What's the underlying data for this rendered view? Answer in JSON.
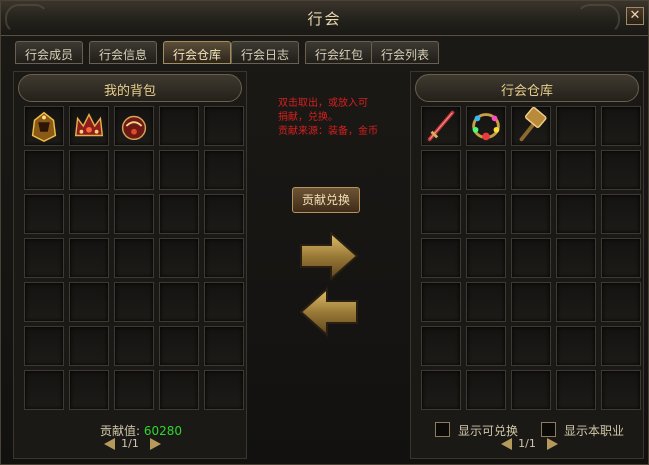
{
  "window": {
    "title": "行会"
  },
  "tabs": [
    {
      "label": "行会成员",
      "active": false
    },
    {
      "label": "行会信息",
      "active": false
    },
    {
      "label": "行会仓库",
      "active": true
    },
    {
      "label": "行会日志",
      "active": false
    },
    {
      "label": "行会红包",
      "active": false
    },
    {
      "label": "行会列表",
      "active": false
    }
  ],
  "left_panel": {
    "title": "我的背包",
    "contribution_label": "贡献值:",
    "contribution_value": "60280",
    "pager": "1/1",
    "items": [
      "helmet-icon",
      "crown-icon",
      "helm-icon"
    ]
  },
  "center": {
    "help_lines": [
      "双击取出，或放入可",
      "捐献，兑换。",
      "贡献来源：装备，金币"
    ],
    "exchange_button": "贡献兑换",
    "arrow_right": "transfer-right-arrow",
    "arrow_left": "transfer-left-arrow"
  },
  "right_panel": {
    "title": "行会仓库",
    "pager": "1/1",
    "filter_exchangeable": "显示可兑换",
    "filter_class": "显示本职业",
    "items": [
      "sword-icon",
      "necklace-icon",
      "hammer-icon"
    ]
  },
  "colors": {
    "accent": "#e8cf8c",
    "help_text": "#d61f1f",
    "contribution_value": "#2fd62f"
  }
}
